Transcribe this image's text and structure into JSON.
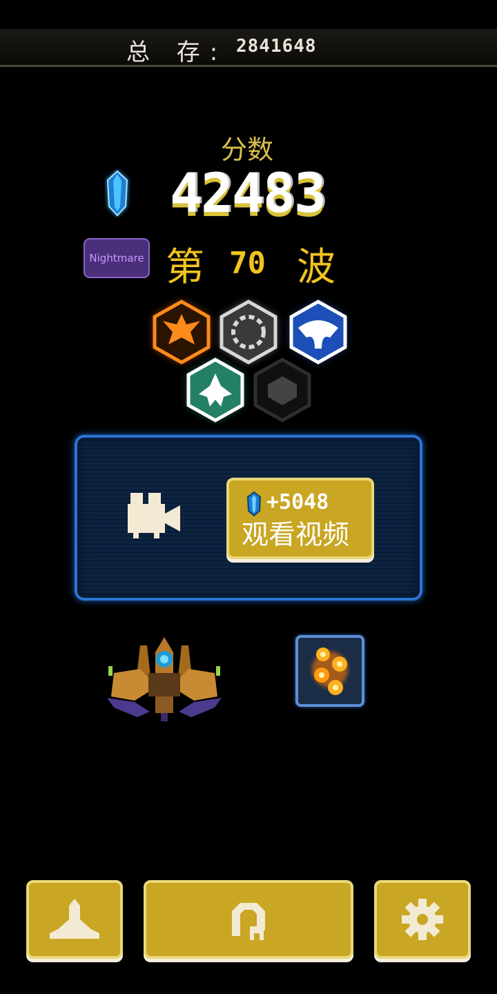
{
  "top_bar": {
    "label": "总 存:",
    "total": "2841648"
  },
  "score": {
    "label": "分数",
    "value": "42483"
  },
  "difficulty": {
    "badge": "Nightmare"
  },
  "wave": {
    "prefix": "第",
    "number": "70",
    "suffix": "波"
  },
  "medals": [
    {
      "name": "orange-phoenix-medal",
      "color": "#ff8a1c"
    },
    {
      "name": "silver-laurel-medal",
      "color": "#d8d8d8"
    },
    {
      "name": "blue-manta-medal",
      "color": "#2a63d8"
    },
    {
      "name": "teal-ship-medal",
      "color": "#2fa98a"
    },
    {
      "name": "locked-medal",
      "color": "#3a3a3a"
    }
  ],
  "reward_panel": {
    "bonus": "+5048",
    "button_label": "观看视频",
    "icon": "video-camera-icon"
  },
  "bottom_bar": {
    "buttons": [
      {
        "name": "hangar-button",
        "icon": "ship-icon"
      },
      {
        "name": "restart-button",
        "icon": "restart-icon"
      },
      {
        "name": "settings-button",
        "icon": "gear-icon"
      }
    ]
  },
  "colors": {
    "accent_gold": "#c9a623",
    "wave_yellow": "#f1c31e",
    "panel_blue": "#2c73d6"
  }
}
